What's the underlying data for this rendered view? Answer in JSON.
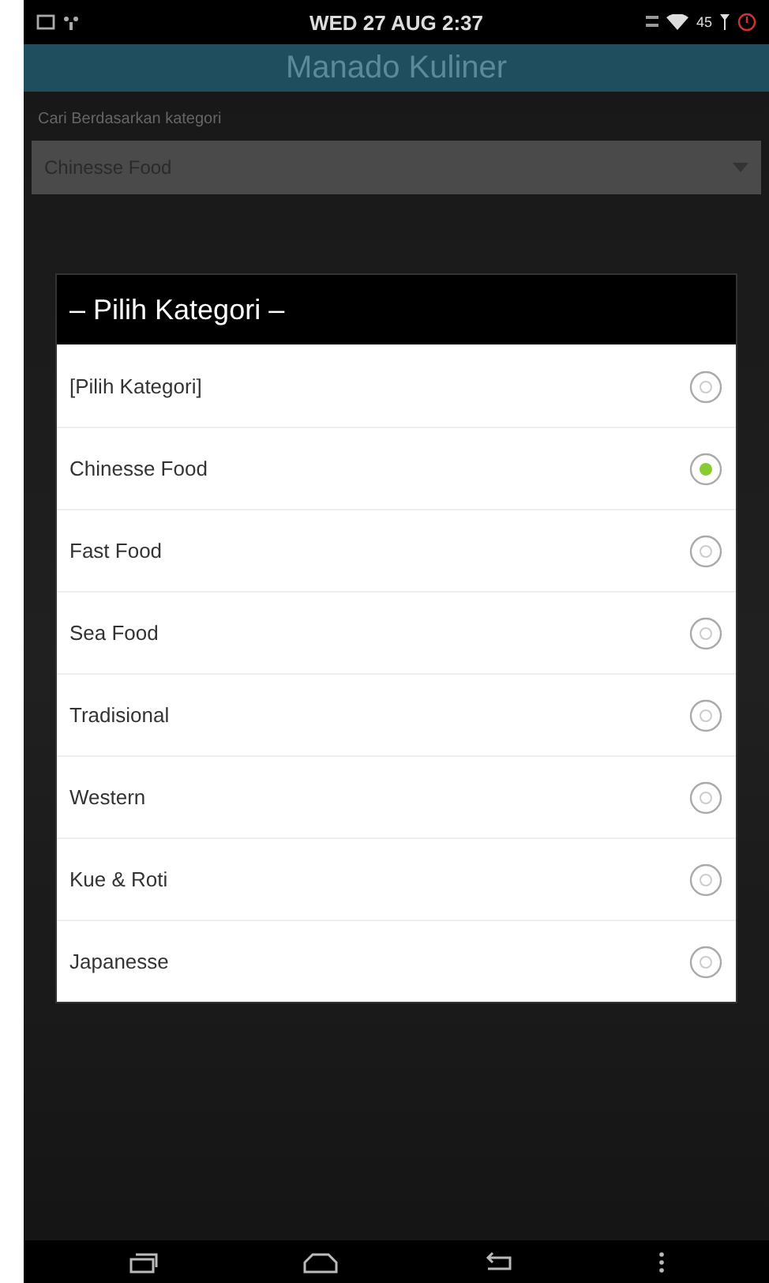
{
  "status_bar": {
    "time": "WED 27 AUG 2:37",
    "battery_text": "45"
  },
  "app_bar": {
    "title": "Manado Kuliner"
  },
  "filter": {
    "label": "Cari Berdasarkan kategori",
    "value": "Chinesse Food"
  },
  "dialog": {
    "title": "– Pilih Kategori –",
    "options": [
      {
        "label": "[Pilih Kategori]",
        "selected": false
      },
      {
        "label": "Chinesse Food",
        "selected": true
      },
      {
        "label": "Fast Food",
        "selected": false
      },
      {
        "label": "Sea Food",
        "selected": false
      },
      {
        "label": "Tradisional",
        "selected": false
      },
      {
        "label": "Western",
        "selected": false
      },
      {
        "label": "Kue & Roti",
        "selected": false
      },
      {
        "label": "Japanesse",
        "selected": false
      }
    ]
  }
}
